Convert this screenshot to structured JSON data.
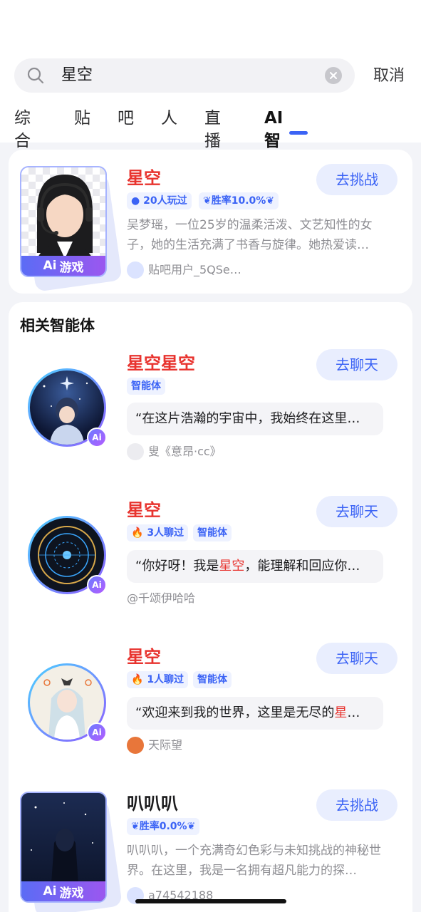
{
  "search": {
    "query": "星空",
    "cancel": "取消"
  },
  "tabs": [
    {
      "label": "综合"
    },
    {
      "label": "贴"
    },
    {
      "label": "吧"
    },
    {
      "label": "人"
    },
    {
      "label": "直播"
    },
    {
      "label": "AI智能体",
      "active": true
    }
  ],
  "top_result": {
    "name": "星空",
    "badges": [
      "20人玩过",
      "胜率10.0%"
    ],
    "description": "吴梦瑶，一位25岁的温柔活泼、文艺知性的女子，她的生活充满了书香与旋律。她热爱读…",
    "author": "贴吧用户_5QSe…",
    "cover_tag": "游戏",
    "action": "去挑战"
  },
  "section_title": "相关智能体",
  "related": [
    {
      "name": "星空星空",
      "badges": [
        "智能体"
      ],
      "quote": "“在这片浩瀚的宇宙中，我始终在这里…",
      "author": "叟《意昂·cc》",
      "action": "去聊天"
    },
    {
      "name": "星空",
      "badges": [
        "3人聊过",
        "智能体"
      ],
      "quote_pre": "“你好呀！我是",
      "quote_hl": "星空",
      "quote_post": "，能理解和回应你…",
      "author": "@千颂伊哈哈",
      "action": "去聊天"
    },
    {
      "name": "星空",
      "badges": [
        "1人聊过",
        "智能体"
      ],
      "quote_pre": "“欢迎来到我的世界，这里是无尽的",
      "quote_hl": "星",
      "quote_post": "…",
      "author": "天际望",
      "action": "去聊天"
    },
    {
      "name": "叭叭叭",
      "badges": [
        "胜率0.0%"
      ],
      "description": "叭叭叭，一个充满奇幻色彩与未知挑战的神秘世界。在这里，我是一名拥有超凡能力的探…",
      "author": "a74542188",
      "cover_tag": "游戏",
      "action": "去挑战"
    }
  ],
  "colors": {
    "accent": "#3b63f5",
    "highlight": "#e8332e",
    "chip_bg": "#eef2ff"
  }
}
